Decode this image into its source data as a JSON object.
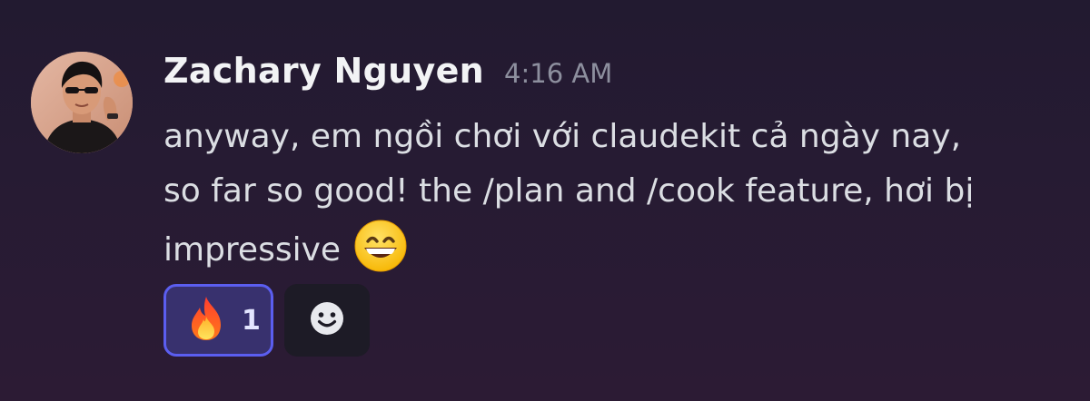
{
  "message": {
    "author": "Zachary Nguyen",
    "timestamp": "4:16 AM",
    "text_lines": [
      "anyway, em ngồi chơi với claudekit cả ngày nay,",
      "so far so good! the /plan and /cook feature, hơi bị",
      "impressive"
    ],
    "inline_emoji": "grinning-face-with-smiling-eyes"
  },
  "reactions": [
    {
      "emoji": "fire",
      "count": "1",
      "active": true
    }
  ],
  "add_reaction": {
    "icon": "smile-face-icon"
  },
  "colors": {
    "background_top": "#221a30",
    "background_bottom": "#2c1b34",
    "username": "#f2f3f5",
    "timestamp": "#8d8f9e",
    "text": "#dbdee3",
    "reaction_active_bg": "#38316e",
    "reaction_active_border": "#5b5ef0",
    "add_reaction_bg": "#1d1b26"
  }
}
